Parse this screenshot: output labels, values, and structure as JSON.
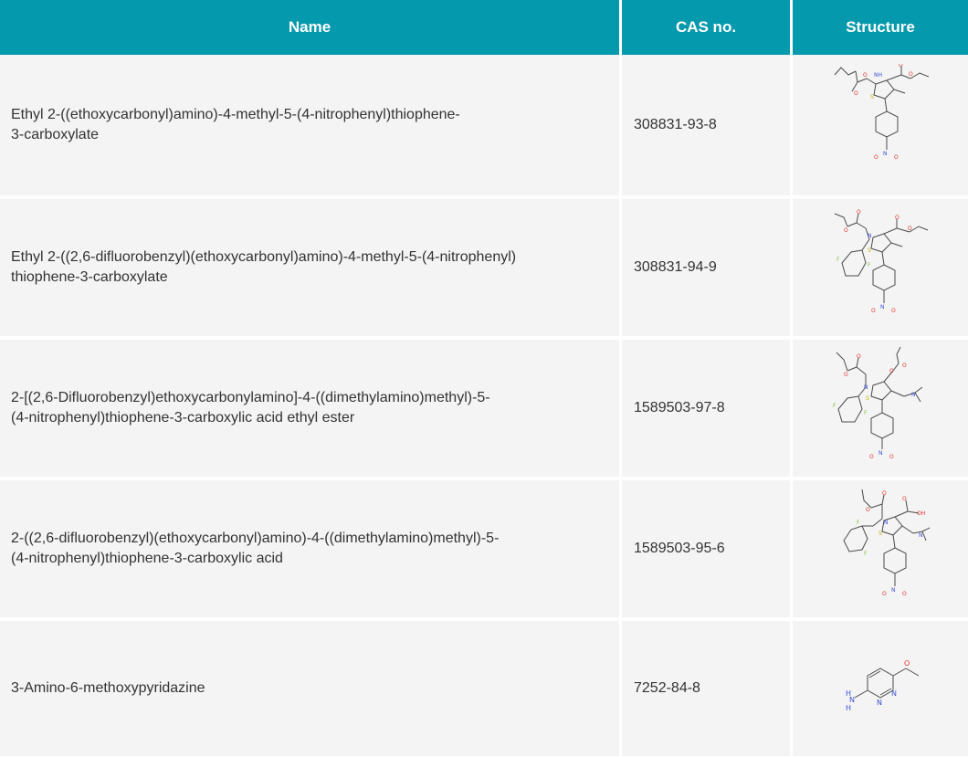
{
  "header": {
    "name": "Name",
    "cas": "CAS no.",
    "structure": "Structure"
  },
  "rows": [
    {
      "name_line1": "Ethyl 2-((ethoxycarbonyl)amino)-4-methyl-5-(4-nitrophenyl)thiophene-",
      "name_line2": "3-carboxylate",
      "cas": "308831-93-8",
      "structure_icon": "chemical-structure-icon"
    },
    {
      "name_line1": "Ethyl 2-((2,6-difluorobenzyl)(ethoxycarbonyl)amino)-4-methyl-5-(4-nitrophenyl)",
      "name_line2": "thiophene-3-carboxylate",
      "cas": "308831-94-9",
      "structure_icon": "chemical-structure-icon"
    },
    {
      "name_line1": "2-[(2,6-Difluorobenzyl)ethoxycarbonylamino]-4-((dimethylamino)methyl)-5-",
      "name_line2": "(4-nitrophenyl)thiophene-3-carboxylic acid ethyl ester",
      "cas": "1589503-97-8",
      "structure_icon": "chemical-structure-icon"
    },
    {
      "name_line1": "2-((2,6-difluorobenzyl)(ethoxycarbonyl)amino)-4-((dimethylamino)methyl)-5-",
      "name_line2": "(4-nitrophenyl)thiophene-3-carboxylic acid",
      "cas": "1589503-95-6",
      "structure_icon": "chemical-structure-icon"
    },
    {
      "name_line1": "3-Amino-6-methoxypyridazine",
      "cas": "7252-84-8",
      "structure_icon": "chemical-structure-icon"
    }
  ],
  "colors": {
    "header_bg": "#0499ad",
    "row_bg": "#f4f4f4",
    "text": "#333333",
    "bond": "#4a4a4a",
    "oxygen": "#e8322c",
    "nitrogen": "#3a4fd6",
    "sulfur": "#c9b200",
    "fluorine": "#8bbf3c"
  }
}
